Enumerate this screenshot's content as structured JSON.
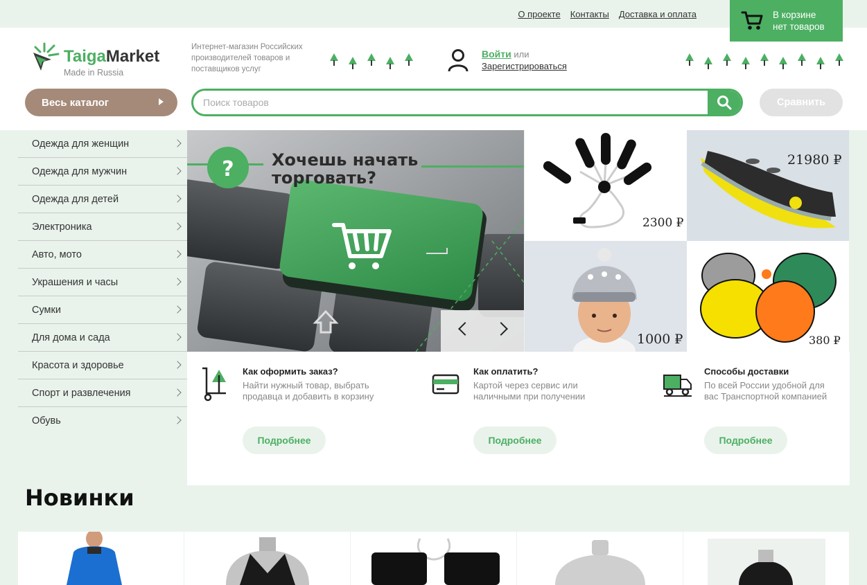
{
  "top_nav": {
    "links": [
      "О проекте",
      "Контакты",
      "Доставка и оплата"
    ]
  },
  "cart": {
    "label": "В корзине",
    "status": "нет товаров"
  },
  "logo": {
    "brand_part1": "Taiga",
    "brand_part2": "Market",
    "subtitle": "Made in Russia"
  },
  "tagline": "Интернет-магазин Российских производителей товаров и поставщиков услуг",
  "account": {
    "login": "Войти",
    "or": " или",
    "register": "Зарегистрироваться"
  },
  "catalog_button": "Весь каталог",
  "search": {
    "placeholder": "Поиск товаров",
    "value": ""
  },
  "compare_button": "Сравнить",
  "categories": [
    "Одежда для женщин",
    "Одежда для мужчин",
    "Одежда для детей",
    "Электроника",
    "Авто, мото",
    "Украшения и часы",
    "Сумки",
    "Для дома и сада",
    "Красота и здоровье",
    "Спорт и развлечения",
    "Обувь"
  ],
  "banner": {
    "headline_line1": "Хочешь начать",
    "headline_line2": "торговать?",
    "question_mark": "?"
  },
  "featured_products": [
    {
      "price": "2300 ₽",
      "icon": "usb-heater-image"
    },
    {
      "price": "21980 ₽",
      "icon": "inflatable-banana-boat-image"
    },
    {
      "price": "1000 ₽",
      "icon": "child-in-knit-hat-image"
    },
    {
      "price": "380 ₽",
      "icon": "colored-sled-pads-image"
    }
  ],
  "info_blocks": [
    {
      "title": "Как оформить заказ?",
      "description": "Найти нужный товар, выбрать продавца и добавить в корзину",
      "button": "Подробнее",
      "icon": "cart-tree-icon"
    },
    {
      "title": "Как оплатить?",
      "description": "Картой через сервис или наличными при получении",
      "button": "Подробнее",
      "icon": "credit-card-icon"
    },
    {
      "title": "Способы доставки",
      "description": "По всей России удобной для вас Транспортной компанией",
      "button": "Подробнее",
      "icon": "delivery-truck-icon"
    }
  ],
  "new_section": {
    "title": "Новинки"
  },
  "colors": {
    "accent_green": "#4caf62",
    "catalog_brown": "#a58a79",
    "background_mint": "#e9f3ec"
  }
}
